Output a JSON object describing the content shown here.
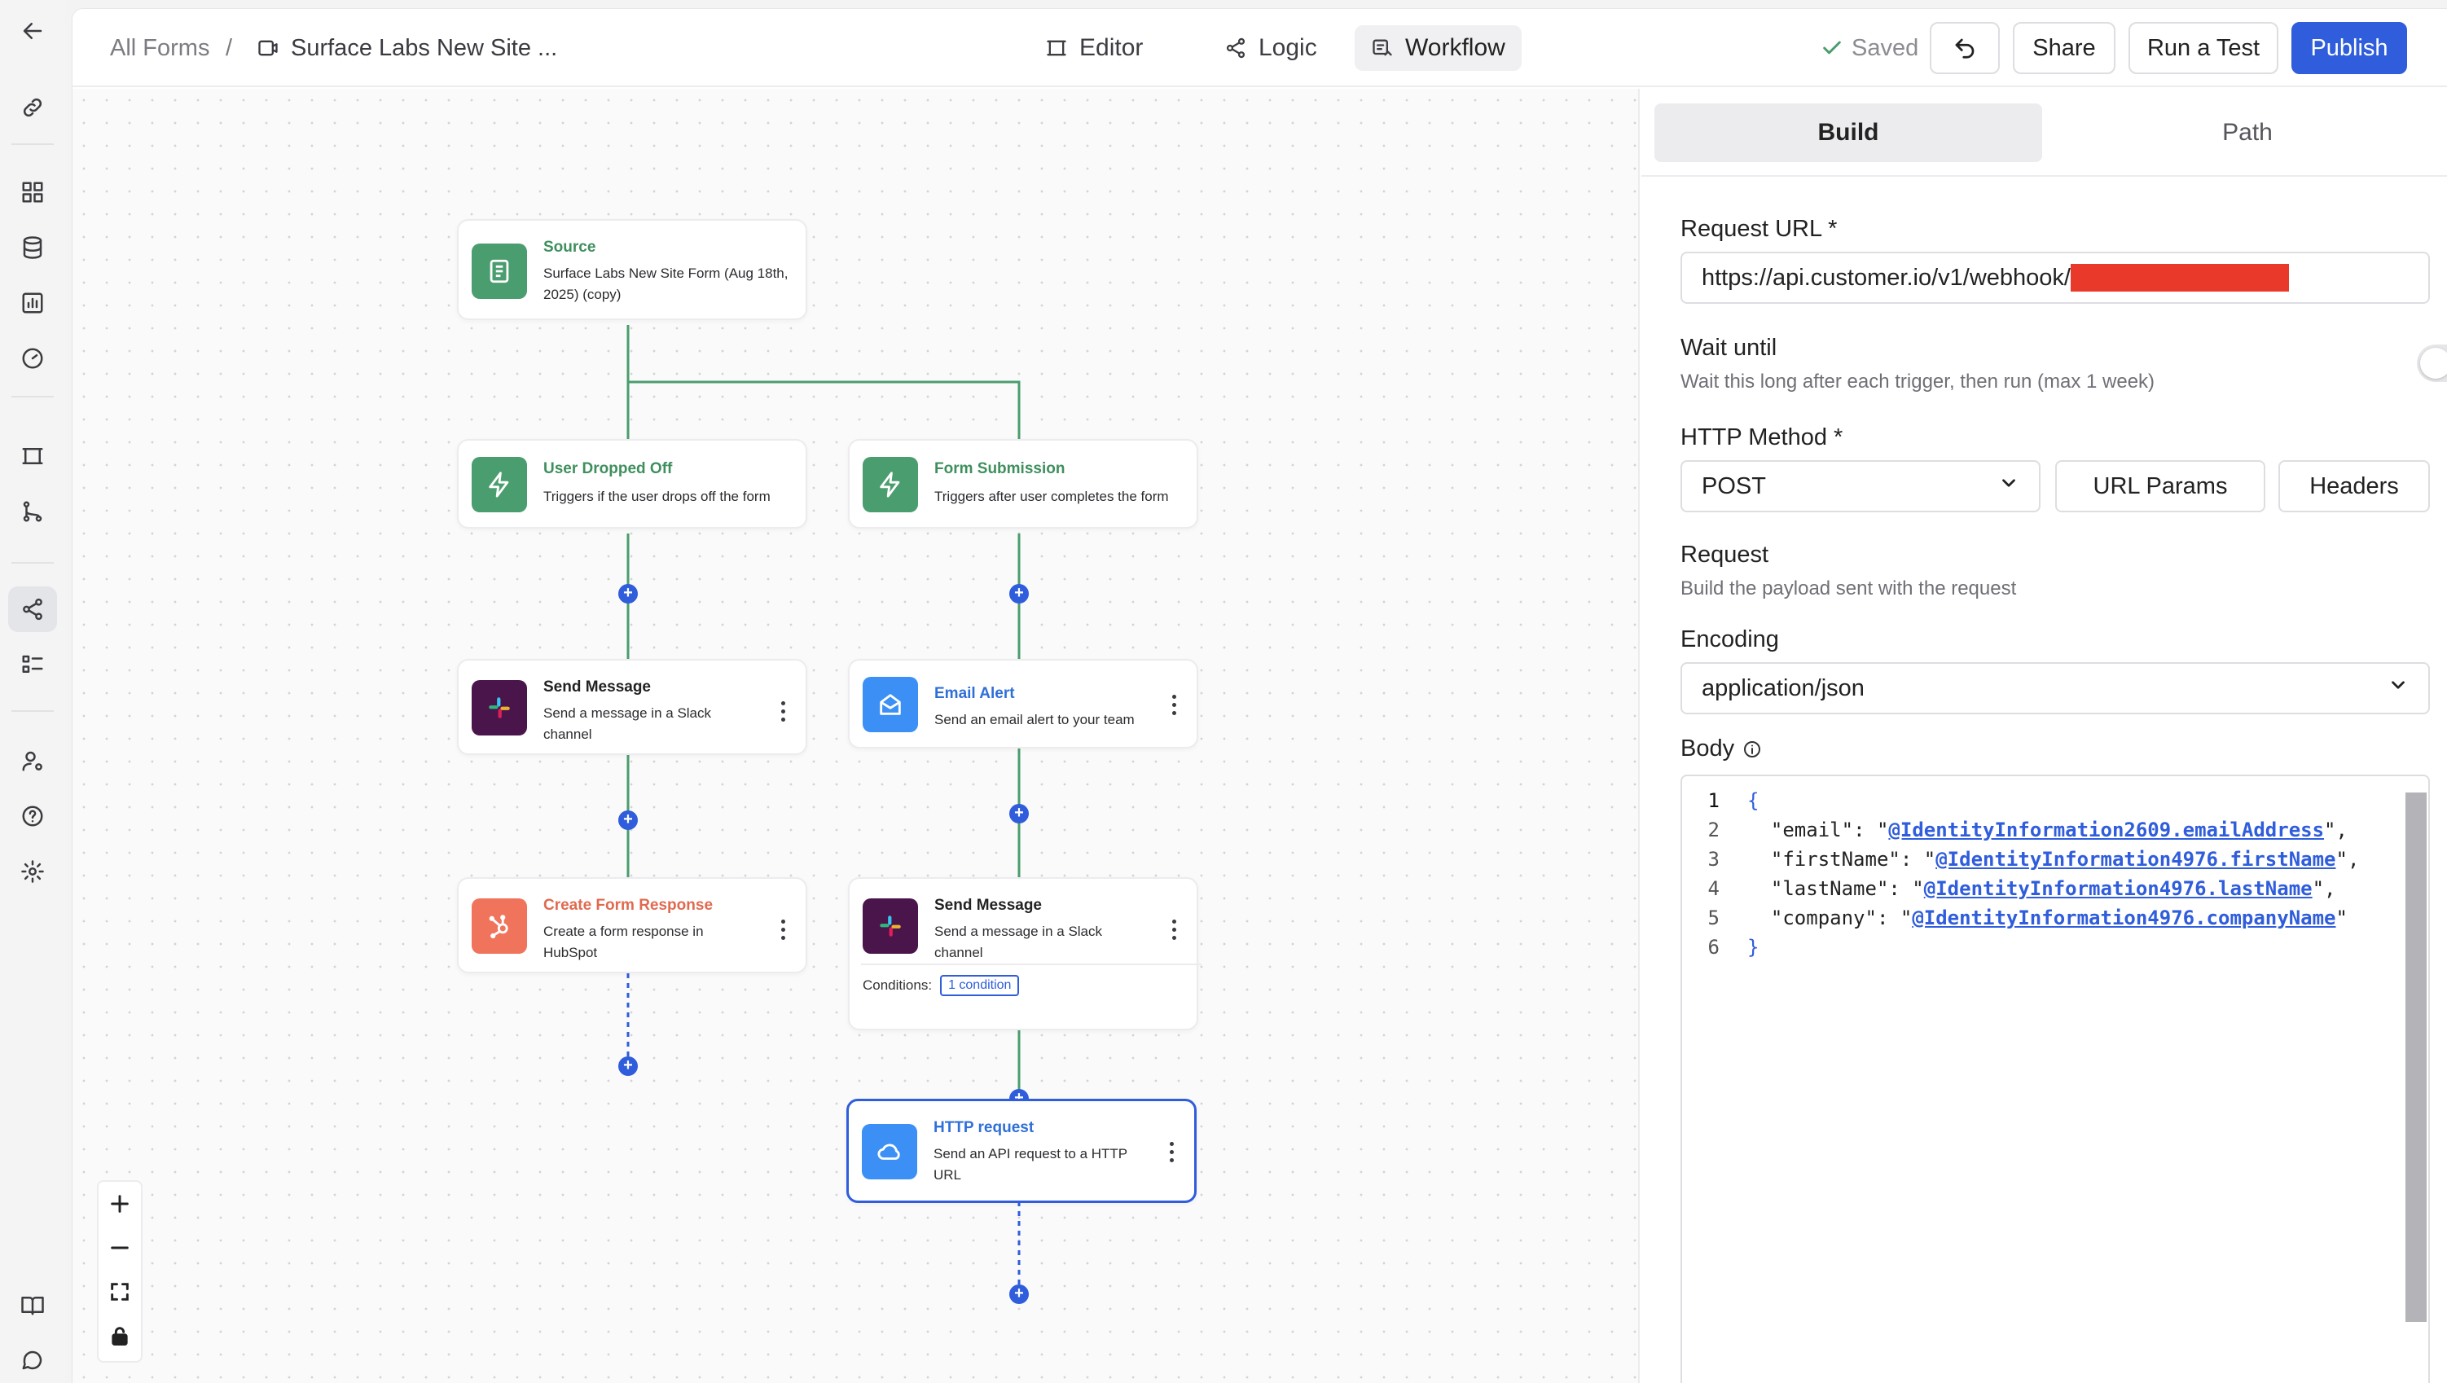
{
  "breadcrumb": {
    "root": "All Forms",
    "separator": "/",
    "form_title": "Surface Labs New Site ..."
  },
  "view_tabs": [
    {
      "label": "Editor",
      "icon": "frame-icon"
    },
    {
      "label": "Logic",
      "icon": "share-nodes-icon"
    },
    {
      "label": "Workflow",
      "icon": "workflow-icon",
      "active": true
    }
  ],
  "header": {
    "saved_label": "Saved",
    "share_label": "Share",
    "run_test_label": "Run a Test",
    "publish_label": "Publish"
  },
  "colors": {
    "accent": "#2f5ddb",
    "green": "#4a9d6e",
    "hubspot": "#f0745c",
    "slack_bg": "#4a154b",
    "email_blue": "#3c8ff5",
    "redaction": "#e8392b"
  },
  "workflow": {
    "source": {
      "title": "Source",
      "desc": "Surface Labs New Site Form (Aug 18th, 2025) (copy)"
    },
    "trigger_dropped": {
      "title": "User Dropped Off",
      "desc": "Triggers if the user drops off the form"
    },
    "trigger_submission": {
      "title": "Form Submission",
      "desc": "Triggers after user completes the form"
    },
    "slack_left": {
      "title": "Send Message",
      "desc": "Send a message in a Slack channel"
    },
    "email_alert": {
      "title": "Email Alert",
      "desc": "Send an email alert to your team"
    },
    "hubspot": {
      "title": "Create Form Response",
      "desc": "Create a form response in HubSpot"
    },
    "slack_right": {
      "title": "Send Message",
      "desc": "Send a message in a Slack channel",
      "conditions_label": "Conditions:",
      "conditions_value": "1 condition"
    },
    "http": {
      "title": "HTTP request",
      "desc": "Send an API request to a HTTP URL"
    },
    "plus_symbol": "+"
  },
  "panel": {
    "tabs": [
      {
        "label": "Build",
        "active": true
      },
      {
        "label": "Path"
      }
    ],
    "request_url_label": "Request URL *",
    "request_url_value": "https://api.customer.io/v1/webhook/",
    "wait_until_label": "Wait until",
    "wait_until_desc": "Wait this long after each trigger, then run (max 1 week)",
    "wait_until_enabled": false,
    "http_method_label": "HTTP Method *",
    "http_method_value": "POST",
    "url_params_label": "URL Params",
    "headers_label": "Headers",
    "request_label": "Request",
    "request_desc": "Build the payload sent with the request",
    "encoding_label": "Encoding",
    "encoding_value": "application/json",
    "body_label": "Body",
    "body_lines": [
      {
        "n": "1",
        "open": "{"
      },
      {
        "n": "2",
        "key": "\"email\"",
        "ref": "@IdentityInformation2609.emailAddress",
        "tail": "\","
      },
      {
        "n": "3",
        "key": "\"firstName\"",
        "ref": "@IdentityInformation4976.firstName",
        "tail": "\","
      },
      {
        "n": "4",
        "key": "\"lastName\"",
        "ref": "@IdentityInformation4976.lastName",
        "tail": "\","
      },
      {
        "n": "5",
        "key": "\"company\"",
        "ref": "@IdentityInformation4976.companyName",
        "tail": "\""
      },
      {
        "n": "6",
        "open": "}"
      }
    ]
  }
}
